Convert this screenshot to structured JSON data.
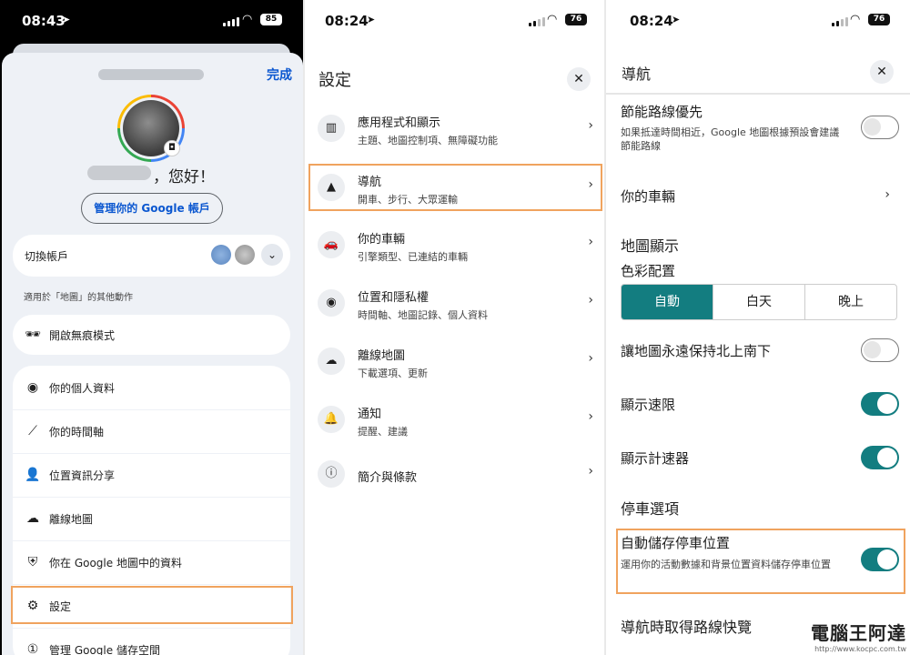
{
  "panel1": {
    "status": {
      "time": "08:43",
      "battery": "85"
    },
    "done_label": "完成",
    "greeting": "，您好！",
    "manage_account": "管理你的 Google 帳戶",
    "switch_account": "切換帳戶",
    "other_actions_caption": "適用於「地圖」的其他動作",
    "incognito": "開啟無痕模式",
    "menu": [
      {
        "label": "你的個人資料",
        "icon": "person-circle-icon",
        "glyph": "◉"
      },
      {
        "label": "你的時間軸",
        "icon": "timeline-icon",
        "glyph": "⟋"
      },
      {
        "label": "位置資訊分享",
        "icon": "share-person-icon",
        "glyph": "👤"
      },
      {
        "label": "離線地圖",
        "icon": "cloud-off-icon",
        "glyph": "☁"
      },
      {
        "label": "你在 Google 地圖中的資料",
        "icon": "shield-icon",
        "glyph": "⛨"
      },
      {
        "label": "設定",
        "icon": "gear-icon",
        "glyph": "⚙"
      },
      {
        "label": "管理 Google 儲存空間",
        "icon": "storage-icon",
        "glyph": "①"
      }
    ]
  },
  "panel2": {
    "status": {
      "time": "08:24",
      "battery": "76"
    },
    "title": "設定",
    "items": [
      {
        "title": "應用程式和顯示",
        "sub": "主題、地圖控制項、無障礙功能",
        "icon": "map-icon",
        "glyph": "▥"
      },
      {
        "title": "導航",
        "sub": "開車、步行、大眾運輸",
        "icon": "navigation-arrow-icon",
        "glyph": "▲"
      },
      {
        "title": "你的車輛",
        "sub": "引擎類型、已連結的車輛",
        "icon": "car-icon",
        "glyph": "🚗"
      },
      {
        "title": "位置和隱私權",
        "sub": "時間軸、地圖記錄、個人資料",
        "icon": "location-pin-icon",
        "glyph": "◉"
      },
      {
        "title": "離線地圖",
        "sub": "下載選項、更新",
        "icon": "cloud-off-icon",
        "glyph": "☁"
      },
      {
        "title": "通知",
        "sub": "提醒、建議",
        "icon": "bell-icon",
        "glyph": "🔔"
      },
      {
        "title": "簡介與條款",
        "sub": "",
        "icon": "info-icon",
        "glyph": "ⓘ"
      }
    ]
  },
  "panel3": {
    "status": {
      "time": "08:24",
      "battery": "76"
    },
    "title": "導航",
    "eco_title": "節能路線優先",
    "eco_sub": "如果抵達時間相近，Google 地圖根據預設會建議節能路線",
    "your_vehicle": "你的車輛",
    "map_display": "地圖顯示",
    "color_scheme": "色彩配置",
    "scheme_options": [
      "自動",
      "白天",
      "晚上"
    ],
    "keep_north": "讓地圖永遠保持北上南下",
    "show_speed_limit": "顯示速限",
    "show_speedometer": "顯示計速器",
    "parking_options": "停車選項",
    "auto_save_parking": "自動儲存停車位置",
    "auto_save_parking_sub": "運用你的活動數據和背景位置資料儲存停車位置",
    "route_preview": "導航時取得路線快覽",
    "toggles": {
      "eco": false,
      "keep_north": false,
      "speed_limit": true,
      "speedometer": true,
      "auto_parking": true
    }
  },
  "watermark": {
    "name": "電腦王阿達",
    "url": "http://www.kocpc.com.tw"
  },
  "colors": {
    "accent": "#137d80",
    "highlight": "#f0a35e",
    "link": "#0b57d0"
  }
}
